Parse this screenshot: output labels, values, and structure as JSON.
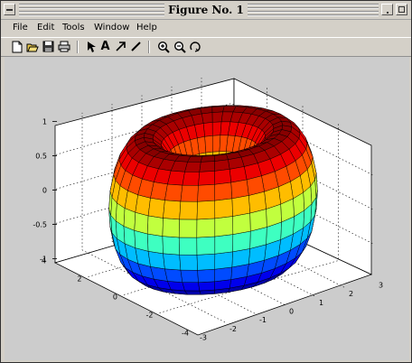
{
  "window": {
    "title": "Figure No. 1"
  },
  "menu": [
    "File",
    "Edit",
    "Tools",
    "Window",
    "Help"
  ],
  "toolbar": [
    {
      "icon": "new-file-icon"
    },
    {
      "icon": "open-folder-icon"
    },
    {
      "icon": "save-icon"
    },
    {
      "icon": "print-icon"
    },
    {
      "icon": "select-arrow-icon"
    },
    {
      "icon": "text-tool-icon",
      "glyph": "A"
    },
    {
      "icon": "arrow-tool-icon"
    },
    {
      "icon": "line-tool-icon"
    },
    {
      "icon": "zoom-in-icon"
    },
    {
      "icon": "zoom-out-icon"
    },
    {
      "icon": "rotate-3d-icon"
    }
  ],
  "plot": {
    "surface": "torus",
    "colormap": "jet",
    "grid": true,
    "z_ticks": [
      "1",
      "0.5",
      "0",
      "-0.5",
      "-1"
    ],
    "y_ticks": [
      "4",
      "2",
      "0",
      "-2",
      "-4"
    ],
    "x_ticks": [
      "-3",
      "-2",
      "-1",
      "0",
      "1",
      "2",
      "3"
    ],
    "colors": {
      "background": "#cccccc",
      "axes": "#000000"
    }
  }
}
